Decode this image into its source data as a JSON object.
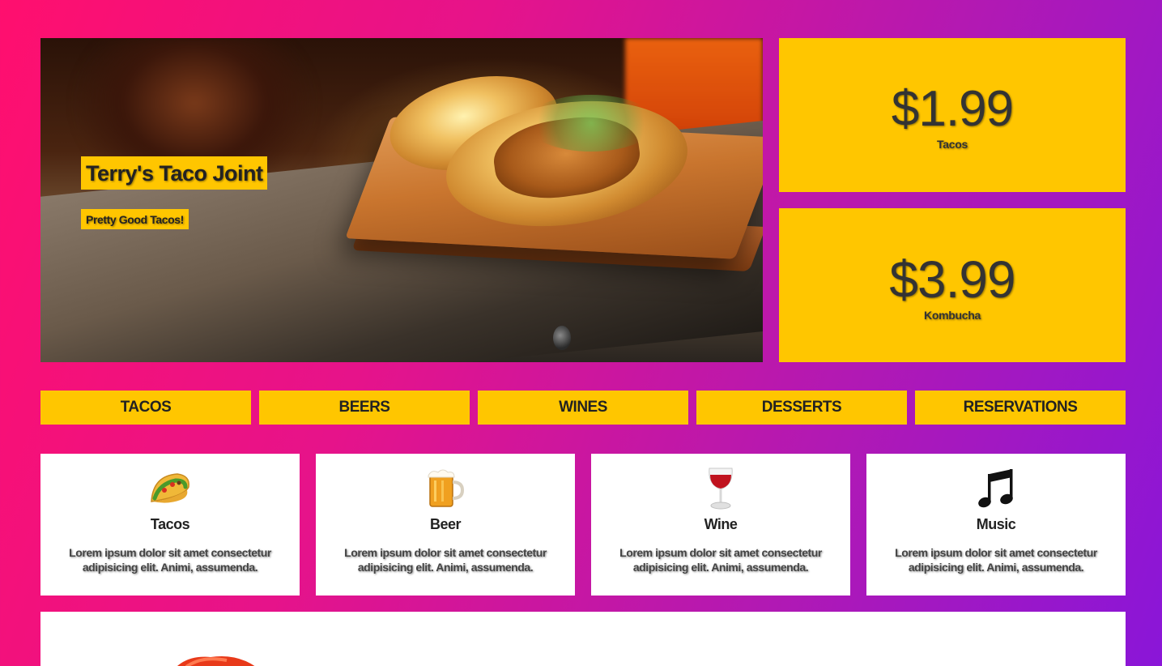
{
  "hero": {
    "title": "Terry's Taco Joint",
    "tagline": "Pretty Good Tacos!"
  },
  "prices": [
    {
      "price": "$1.99",
      "label": "Tacos"
    },
    {
      "price": "$3.99",
      "label": "Kombucha"
    }
  ],
  "nav": {
    "items": [
      {
        "label": "TACOS"
      },
      {
        "label": "BEERS"
      },
      {
        "label": "WINES"
      },
      {
        "label": "DESSERTS"
      },
      {
        "label": "RESERVATIONS"
      }
    ]
  },
  "features": [
    {
      "icon": "taco-icon",
      "title": "Tacos",
      "description": "Lorem ipsum dolor sit amet consectetur adipisicing elit. Animi, assumenda."
    },
    {
      "icon": "beer-icon",
      "title": "Beer",
      "description": "Lorem ipsum dolor sit amet consectetur adipisicing elit. Animi, assumenda."
    },
    {
      "icon": "wine-icon",
      "title": "Wine",
      "description": "Lorem ipsum dolor sit amet consectetur adipisicing elit. Animi, assumenda."
    },
    {
      "icon": "music-icon",
      "title": "Music",
      "description": "Lorem ipsum dolor sit amet consectetur adipisicing elit. Animi, assumenda."
    }
  ],
  "colors": {
    "accent": "#ffc600",
    "gradient_start": "#ff0f6e",
    "gradient_end": "#8a16d8",
    "card_background": "#ffffff"
  }
}
